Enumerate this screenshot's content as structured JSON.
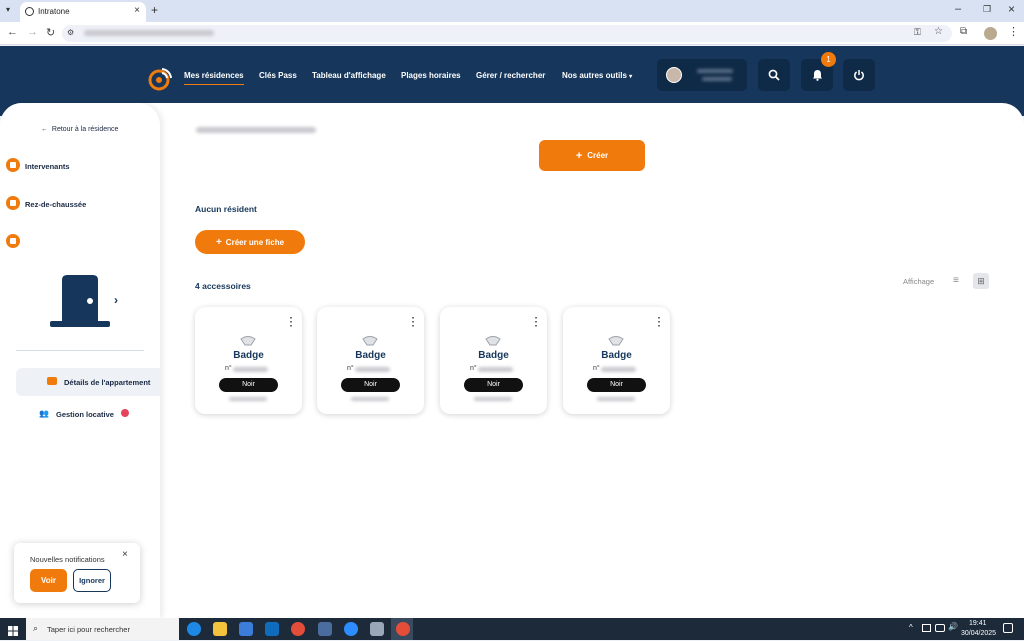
{
  "browser": {
    "tab_title": "Intratone",
    "tab_close": "×",
    "new_tab": "+",
    "win_min": "–",
    "win_restore": "❐",
    "win_close": "×"
  },
  "header": {
    "menu": [
      "Mes résidences",
      "Clés Pass",
      "Tableau d'affichage",
      "Plages horaires",
      "Gérer / rechercher",
      "Nos autres outils"
    ],
    "notif_count": "1"
  },
  "sidebar": {
    "back": "Retour à la résidence",
    "items": [
      "Intervenants",
      "Rez-de-chaussée"
    ],
    "nav": [
      {
        "label": "Détails de l'appartement"
      },
      {
        "label": "Gestion locative"
      }
    ]
  },
  "main": {
    "create_label": "Créer",
    "no_resident": "Aucun résident",
    "create_sheet": "Créer une fiche",
    "accessories_title": "4 accessoires",
    "display_label": "Affichage",
    "cards": [
      {
        "name": "Badge",
        "num": "n°",
        "color": "Noir"
      },
      {
        "name": "Badge",
        "num": "n°",
        "color": "Noir"
      },
      {
        "name": "Badge",
        "num": "n°",
        "color": "Noir"
      },
      {
        "name": "Badge",
        "num": "n°",
        "color": "Noir"
      }
    ]
  },
  "notification": {
    "title": "Nouvelles notifications",
    "see": "Voir",
    "ignore": "Ignorer",
    "close": "×"
  },
  "taskbar": {
    "search_placeholder": "Taper ici pour rechercher",
    "time": "19:41",
    "date": "30/04/2025"
  },
  "colors": {
    "accent": "#f07a0c",
    "navy": "#16375b"
  }
}
